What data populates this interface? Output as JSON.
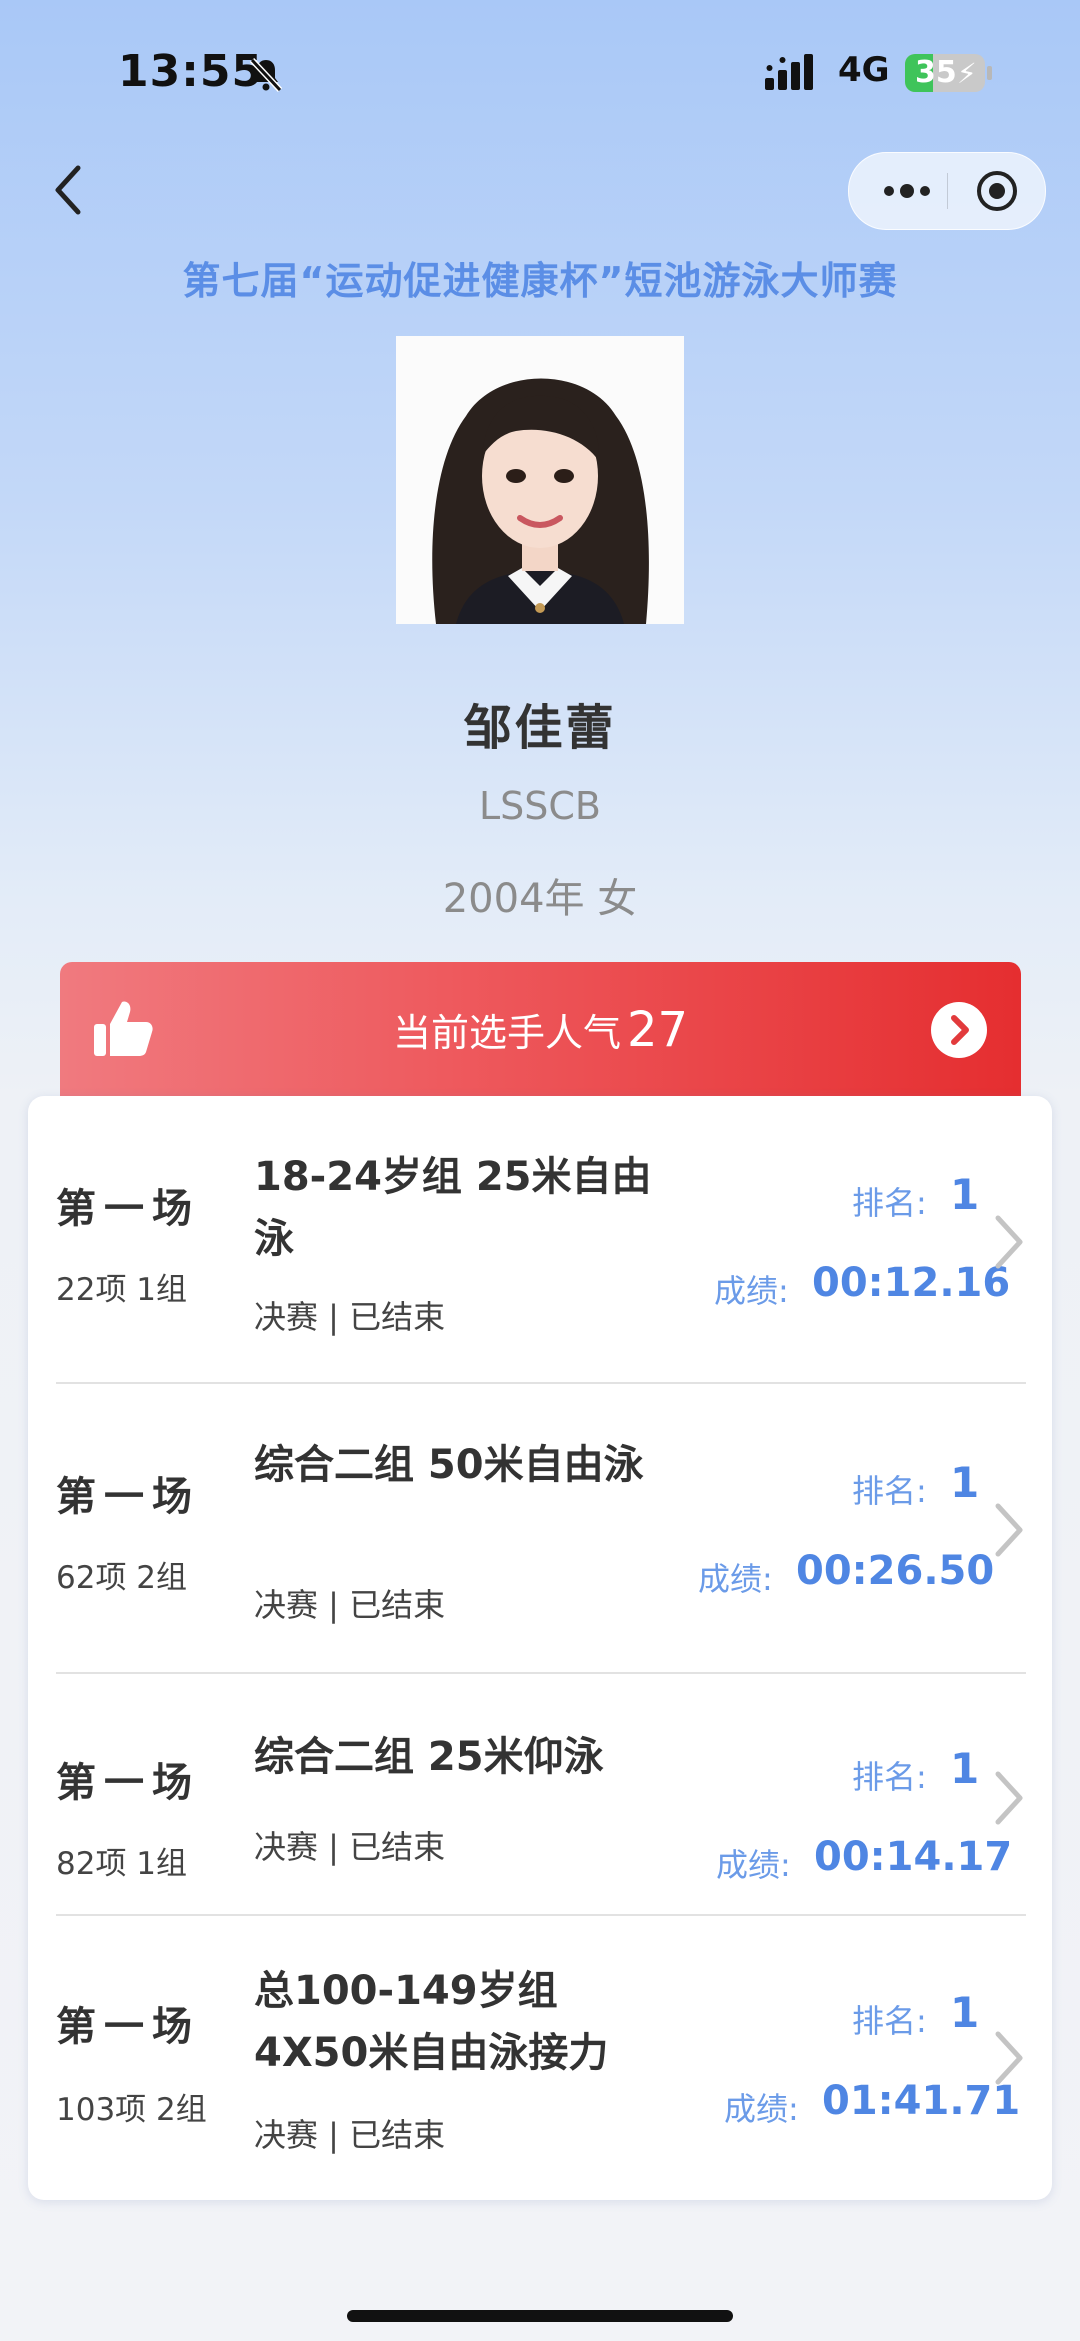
{
  "status_bar": {
    "time": "13:55",
    "network": "4G",
    "battery": "35",
    "battery_level": 0.35
  },
  "nav": {
    "title": "第七届“运动促进健康杯”短池游泳大师赛"
  },
  "athlete": {
    "name": "邹佳蕾",
    "club": "LSSCB",
    "meta": "2004年  女"
  },
  "popularity": {
    "label": "当前选手人气",
    "count": "27"
  },
  "results": [
    {
      "session": "第一场",
      "item": "22项 1组",
      "event": "18-24岁组 25米自由泳",
      "status": "决赛 | 已结束",
      "rank_label": "排名:",
      "rank": "1",
      "score_label": "成绩:",
      "score": "00:12.16"
    },
    {
      "session": "第一场",
      "item": "62项 2组",
      "event": "综合二组 50米自由泳",
      "status": "决赛 | 已结束",
      "rank_label": "排名:",
      "rank": "1",
      "score_label": "成绩:",
      "score": "00:26.50"
    },
    {
      "session": "第一场",
      "item": "82项 1组",
      "event": "综合二组 25米仰泳",
      "status": "决赛 | 已结束",
      "rank_label": "排名:",
      "rank": "1",
      "score_label": "成绩:",
      "score": "00:14.17"
    },
    {
      "session": "第一场",
      "item": "103项 2组",
      "event": "总100-149岁组 4X50米自由泳接力",
      "status": "决赛 | 已结束",
      "rank_label": "排名:",
      "rank": "1",
      "score_label": "成绩:",
      "score": "01:41.71"
    }
  ],
  "colors": {
    "accent": "#4f86e3",
    "title_blue": "#5b8ee6",
    "banner_red": "#e52e30"
  },
  "icons": [
    "bell-slash-icon",
    "signal-icon",
    "battery-icon",
    "back-chevron-icon",
    "more-dots-icon",
    "target-icon",
    "thumbs-up-icon",
    "arrow-right-circle-icon",
    "chevron-right-icon"
  ]
}
